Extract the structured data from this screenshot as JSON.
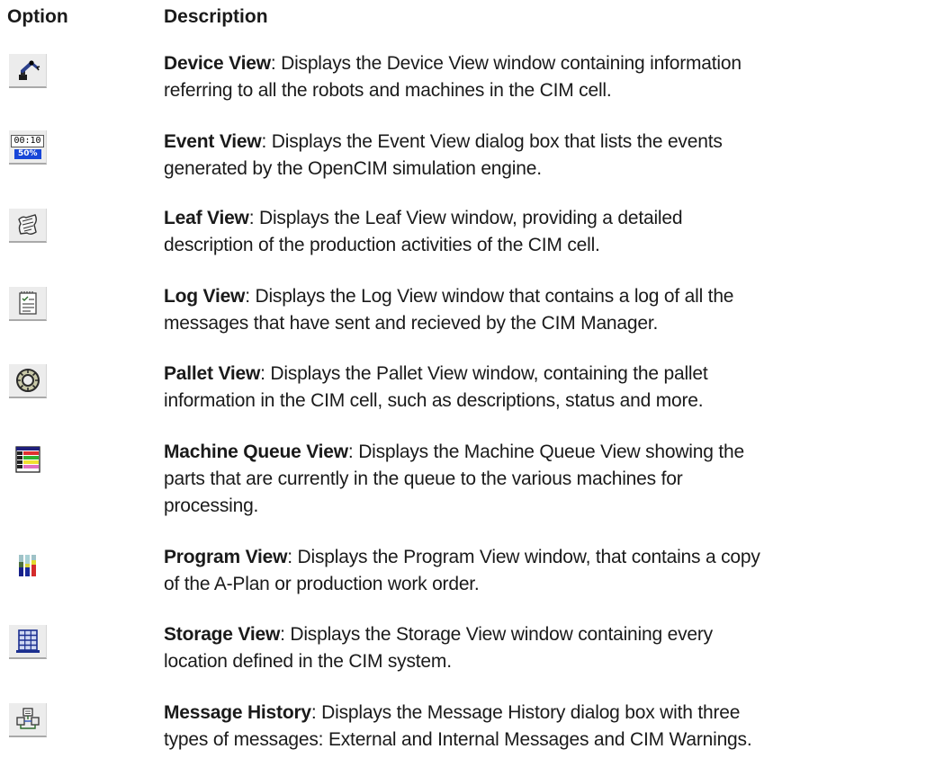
{
  "header": {
    "option": "Option",
    "description": "Description"
  },
  "items": [
    {
      "icon": "robot-arm-icon",
      "name": "Device View",
      "line1": ": Displays the Device View window containing information",
      "line2": "referring to all the robots and machines in the CIM cell.",
      "line3": ""
    },
    {
      "icon": "event-timer-icon",
      "icon_text_top": "00:10",
      "icon_text_bottom": "50%",
      "name": "Event View",
      "line1": ": Displays the Event View dialog box that lists the events",
      "line2": "generated by the OpenCIM simulation engine.",
      "line3": ""
    },
    {
      "icon": "leaf-document-icon",
      "name": "Leaf View",
      "line1": ": Displays the Leaf View window, providing a detailed",
      "line2": "description of the production activities of the CIM cell.",
      "line3": ""
    },
    {
      "icon": "log-notepad-icon",
      "name": "Log View",
      "line1": ": Displays the Log View window that contains a log of all the",
      "line2": "messages that have sent and recieved by the CIM Manager.",
      "line3": ""
    },
    {
      "icon": "pallet-ring-icon",
      "name": "Pallet View",
      "line1": ": Displays the Pallet View window, containing the pallet",
      "line2": "information in the CIM cell, such as descriptions, status and more.",
      "line3": ""
    },
    {
      "icon": "machine-queue-icon",
      "name": "Machine Queue View",
      "line1": ": Displays the Machine Queue View showing the",
      "line2": "parts that are currently in the queue to the various machines for",
      "line3": "processing."
    },
    {
      "icon": "program-bars-icon",
      "name": "Program View",
      "line1": ": Displays the Program View window, that contains a copy",
      "line2": "of the A-Plan or production work order.",
      "line3": ""
    },
    {
      "icon": "storage-rack-icon",
      "name": "Storage View",
      "line1": ": Displays the Storage View window containing every",
      "line2": "location defined in the CIM system.",
      "line3": ""
    },
    {
      "icon": "message-history-icon",
      "name": "Message History",
      "line1": ": Displays the Message History dialog box with three",
      "line2": "types of messages: External and Internal Messages and CIM Warnings.",
      "line3": ""
    }
  ]
}
